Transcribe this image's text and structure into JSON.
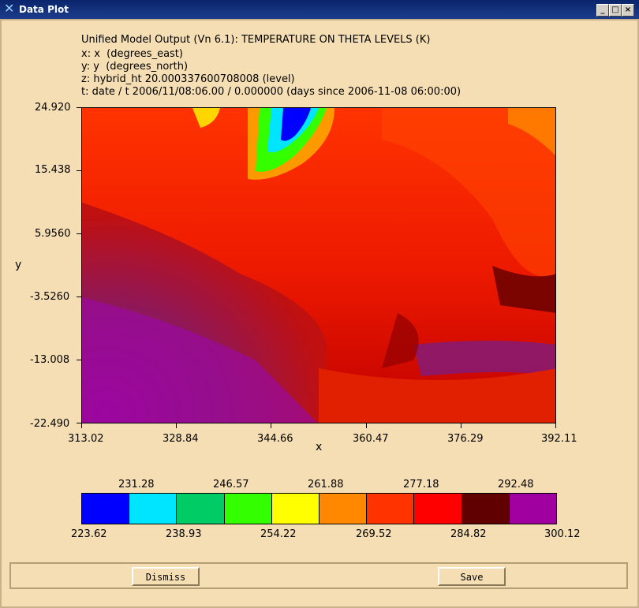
{
  "window": {
    "title": "Data Plot",
    "controls": {
      "minimize": "_",
      "maximize": "□",
      "close": "×"
    }
  },
  "header": {
    "line1": "Unified Model Output (Vn 6.1): TEMPERATURE ON THETA LEVELS (K)",
    "line2": "x: x  (degrees_east)",
    "line3": "y: y  (degrees_north)",
    "line4": "z: hybrid_ht 20.000337600708008 (level)",
    "line5": "t: date / t 2006/11/08:06.00 / 0.000000 (days since 2006-11-08 06:00:00)"
  },
  "chart_data": {
    "type": "heatmap",
    "xlabel": "x",
    "ylabel": "y",
    "x_ticks": [
      "313.02",
      "328.84",
      "344.66",
      "360.47",
      "376.29",
      "392.11"
    ],
    "y_ticks": [
      "24.920",
      "15.438",
      "5.9560",
      "-3.5260",
      "-13.008",
      "-22.490"
    ],
    "xlim": [
      313.02,
      392.11
    ],
    "ylim": [
      -22.49,
      24.92
    ],
    "colorbar": {
      "upper_labels": [
        "231.28",
        "246.57",
        "261.88",
        "277.18",
        "292.48"
      ],
      "lower_labels": [
        "223.62",
        "238.93",
        "254.22",
        "269.52",
        "284.82",
        "300.12"
      ],
      "colors": [
        "#0000ff",
        "#00e5ff",
        "#00cc66",
        "#33ff00",
        "#ffff00",
        "#ff8800",
        "#ff3300",
        "#ff0000",
        "#600000",
        "#a000a0"
      ]
    }
  },
  "buttons": {
    "dismiss": "Dismiss",
    "save": "Save"
  },
  "icons": {
    "app": "x-logo-icon"
  }
}
